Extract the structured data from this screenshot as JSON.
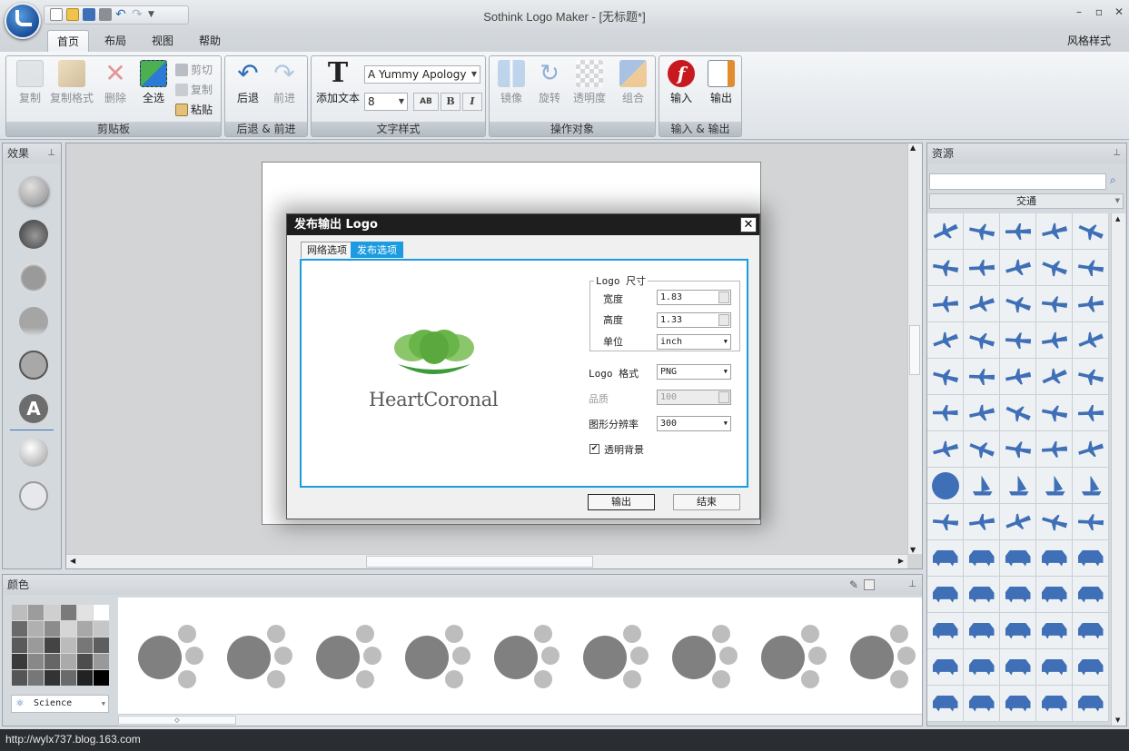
{
  "app": {
    "title": "Sothink Logo Maker - [无标题*]"
  },
  "tabs": [
    "首页",
    "布局",
    "视图",
    "帮助"
  ],
  "style_menu": "风格样式",
  "ribbon": {
    "clipboard": {
      "label": "剪贴板",
      "copy": "复制",
      "copy_format": "复制格式",
      "delete": "删除",
      "select_all": "全选",
      "cut": "剪切",
      "copy2": "复制",
      "paste": "粘贴"
    },
    "undo_group": {
      "label": "后退 & 前进",
      "undo": "后退",
      "redo": "前进"
    },
    "text_group": {
      "label": "文字样式",
      "add_text": "添加文本",
      "font": "A Yummy Apology",
      "size": "8",
      "ab": "AB",
      "bold": "B",
      "italic": "I"
    },
    "ops_group": {
      "label": "操作对象",
      "mirror": "镜像",
      "rotate": "旋转",
      "opacity": "透明度",
      "group": "组合"
    },
    "io_group": {
      "label": "输入 & 输出",
      "import": "输入",
      "export": "输出"
    }
  },
  "effects": {
    "title": "效果",
    "text_effect": "A"
  },
  "colors": {
    "title": "颜色",
    "scheme": "Science"
  },
  "resources": {
    "title": "资源",
    "category": "交通"
  },
  "dialog": {
    "title": "发布输出 Logo",
    "tab_web": "网络选项",
    "tab_publish": "发布选项",
    "logo_text": "HeartCoronal",
    "size_legend": "Logo 尺寸",
    "width_label": "宽度",
    "width_value": "1.83",
    "height_label": "高度",
    "height_value": "1.33",
    "unit_label": "单位",
    "unit_value": "inch",
    "format_label": "Logo 格式",
    "format_value": "PNG",
    "quality_label": "品质",
    "quality_value": "100",
    "dpi_label": "图形分辨率",
    "dpi_value": "300",
    "transparent_label": "透明背景",
    "transparent_checked": true,
    "ok": "输出",
    "cancel": "结束"
  },
  "status": {
    "url": "http://wylx737.blog.163.com"
  },
  "accent_colors": {
    "accent": "#1c9be0",
    "icon_blue": "#3f6fb6",
    "leaf_green": "#6ab54a"
  }
}
